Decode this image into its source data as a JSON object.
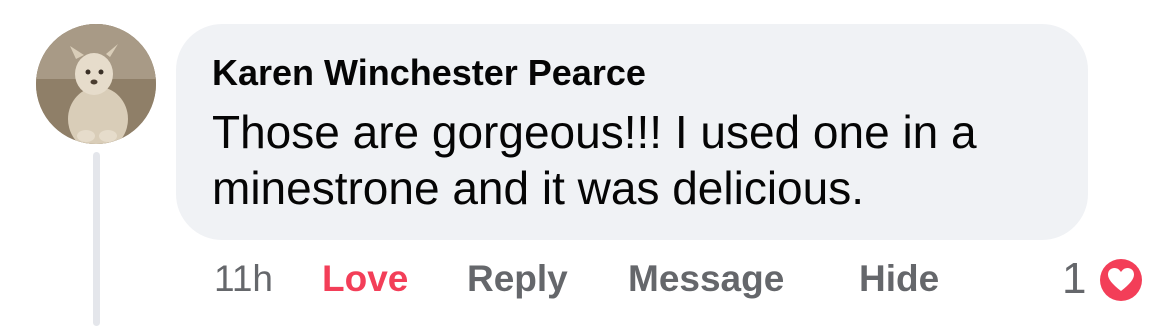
{
  "comment": {
    "author": "Karen Winchester Pearce",
    "text": "Those are gorgeous!!! I used one in a minestrone and it was delicious.",
    "avatar_icon": "profile-photo-dog-icon"
  },
  "actions": {
    "timestamp": "11h",
    "love_label": "Love",
    "reply_label": "Reply",
    "message_label": "Message",
    "hide_label": "Hide"
  },
  "reactions": {
    "count": "1",
    "type_icon": "heart-reaction-icon"
  },
  "colors": {
    "bubble": "#f0f2f5",
    "love": "#f33e58",
    "muted": "#65676b",
    "text": "#050505"
  }
}
